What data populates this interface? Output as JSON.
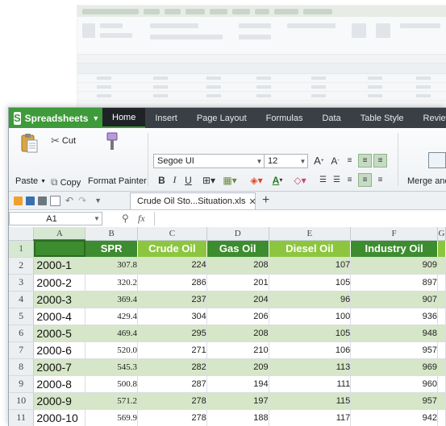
{
  "app": {
    "name": "Spreadsheets",
    "logo_letter": "S"
  },
  "menu": [
    "Home",
    "Insert",
    "Page Layout",
    "Formulas",
    "Data",
    "Table Style",
    "Review"
  ],
  "ribbon": {
    "paste": "Paste",
    "cut": "Cut",
    "copy": "Copy",
    "format_painter": "Format Painter",
    "font_name": "Segoe UI",
    "font_size": "12",
    "bold": "B",
    "italic": "I",
    "underline": "U",
    "merge": "Merge and",
    "grow_font": "A",
    "shrink_font": "A",
    "font_color": "A"
  },
  "quickbar": {
    "doc_tab": "Crude Oil Sto...Situation.xls",
    "new_tab": "+"
  },
  "formula_bar": {
    "name_box": "A1",
    "fx": "fx"
  },
  "columns": [
    "A",
    "B",
    "C",
    "D",
    "E",
    "F",
    "G"
  ],
  "header_row": [
    "",
    "SPR",
    "Crude Oil",
    "Gas Oil",
    "Diesel Oil",
    "Industry Oil",
    ""
  ],
  "rows": [
    {
      "n": "1",
      "cells": []
    },
    {
      "n": "2",
      "cells": [
        "2000-1",
        "307.8",
        "224",
        "208",
        "107",
        "909"
      ]
    },
    {
      "n": "3",
      "cells": [
        "2000-2",
        "320.2",
        "286",
        "201",
        "105",
        "897"
      ]
    },
    {
      "n": "4",
      "cells": [
        "2000-3",
        "369.4",
        "237",
        "204",
        "96",
        "907"
      ]
    },
    {
      "n": "5",
      "cells": [
        "2000-4",
        "429.4",
        "304",
        "206",
        "100",
        "936"
      ]
    },
    {
      "n": "6",
      "cells": [
        "2000-5",
        "469.4",
        "295",
        "208",
        "105",
        "948"
      ]
    },
    {
      "n": "7",
      "cells": [
        "2000-6",
        "520.0",
        "271",
        "210",
        "106",
        "957"
      ]
    },
    {
      "n": "8",
      "cells": [
        "2000-7",
        "545.3",
        "282",
        "209",
        "113",
        "969"
      ]
    },
    {
      "n": "9",
      "cells": [
        "2000-8",
        "500.8",
        "287",
        "194",
        "111",
        "960"
      ]
    },
    {
      "n": "10",
      "cells": [
        "2000-9",
        "571.2",
        "278",
        "197",
        "115",
        "957"
      ]
    },
    {
      "n": "11",
      "cells": [
        "2000-10",
        "569.9",
        "278",
        "188",
        "117",
        "942"
      ]
    }
  ],
  "colors": {
    "header_dark": "#3d8c2f",
    "header_light": "#8cc63e",
    "row_green": "#d6e6c8",
    "app_green": "#3e9a3a"
  }
}
